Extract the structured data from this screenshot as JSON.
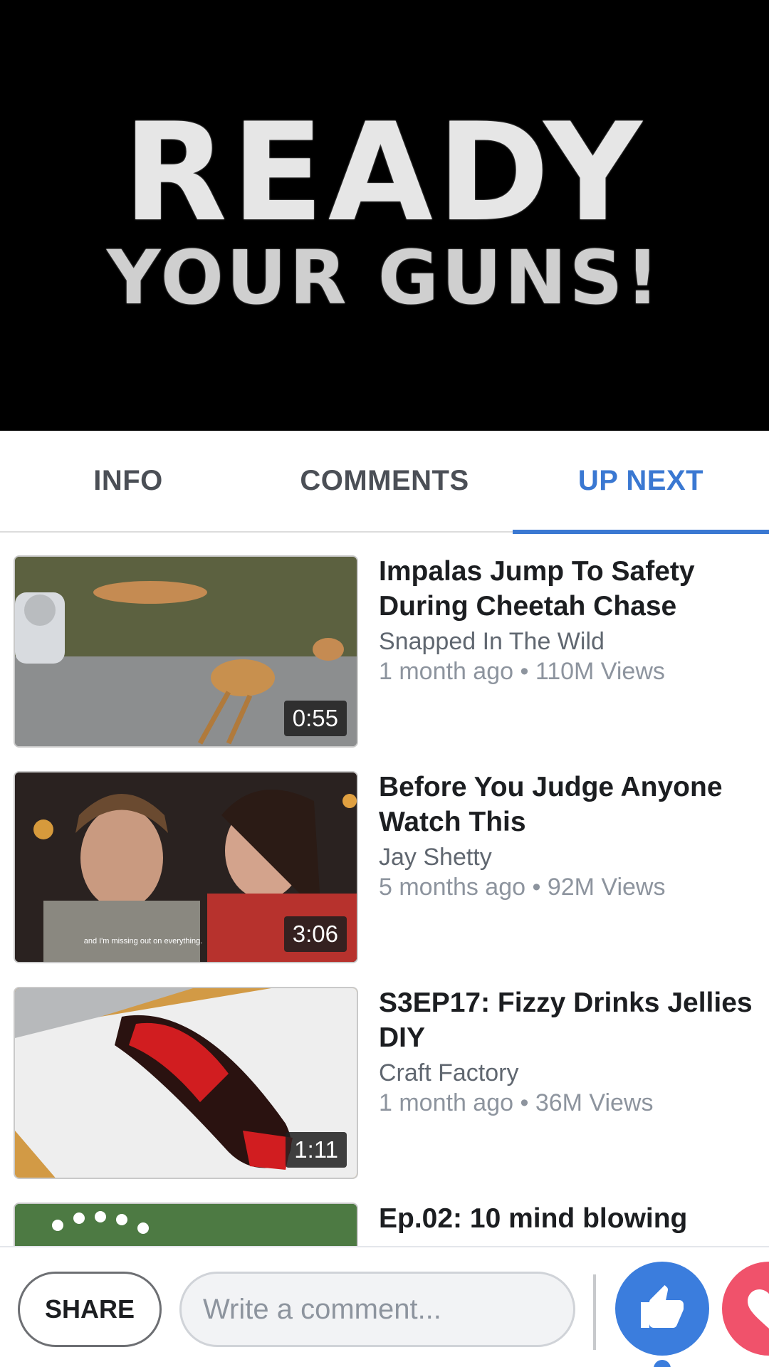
{
  "player": {
    "title_line1": "READY",
    "title_line2": "YOUR GUNS!"
  },
  "tabs": [
    {
      "label": "INFO",
      "active": false
    },
    {
      "label": "COMMENTS",
      "active": false
    },
    {
      "label": "UP NEXT",
      "active": true
    }
  ],
  "videos": [
    {
      "title": "Impalas Jump To Safety During Cheetah Chase",
      "channel": "Snapped In The Wild",
      "stats": "1 month ago • 110M Views",
      "duration": "0:55"
    },
    {
      "title": "Before You Judge Anyone Watch This",
      "channel": "Jay Shetty",
      "stats": "5 months ago • 92M Views",
      "duration": "3:06",
      "caption": "and I'm missing out on everything."
    },
    {
      "title": "S3EP17: Fizzy Drinks Jellies DIY",
      "channel": "Craft Factory",
      "stats": "1 month ago • 36M Views",
      "duration": "1:11"
    },
    {
      "title": "Ep.02: 10 mind blowing"
    }
  ],
  "bottom_bar": {
    "share_label": "SHARE",
    "comment_placeholder": "Write a comment...",
    "like_icon": "thumbs-up-icon",
    "love_icon": "heart-icon"
  },
  "colors": {
    "accent": "#3a78d2",
    "like": "#3b7ddd",
    "love": "#f0526b"
  }
}
